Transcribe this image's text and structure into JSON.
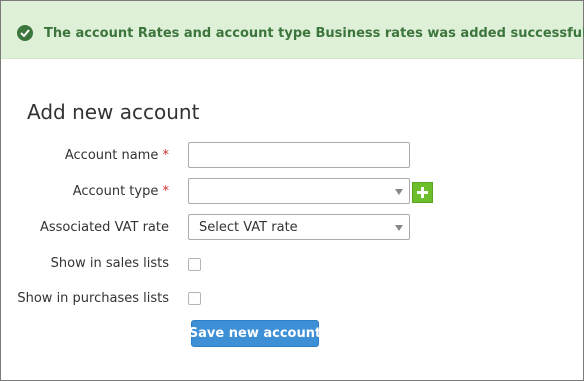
{
  "alert": {
    "icon": "check-circle-icon",
    "message": "The account Rates and account type Business rates was added successfully.",
    "color": "#3c763d",
    "background": "#dff0d8"
  },
  "form": {
    "title": "Add new account",
    "required_marker": "*",
    "account_name": {
      "label": "Account name",
      "value": ""
    },
    "account_type": {
      "label": "Account type",
      "selected": "",
      "add_icon": "plus-icon"
    },
    "vat_rate": {
      "label": "Associated VAT rate",
      "selected": "Select VAT rate"
    },
    "show_in_sales": {
      "label": "Show in sales lists",
      "checked": false
    },
    "show_in_purchases": {
      "label": "Show in purchases lists",
      "checked": false
    },
    "submit_label": "Save new account"
  },
  "colors": {
    "primary_button": "#3d8fd6",
    "add_button": "#6cbf2a",
    "required": "#c9302c"
  }
}
